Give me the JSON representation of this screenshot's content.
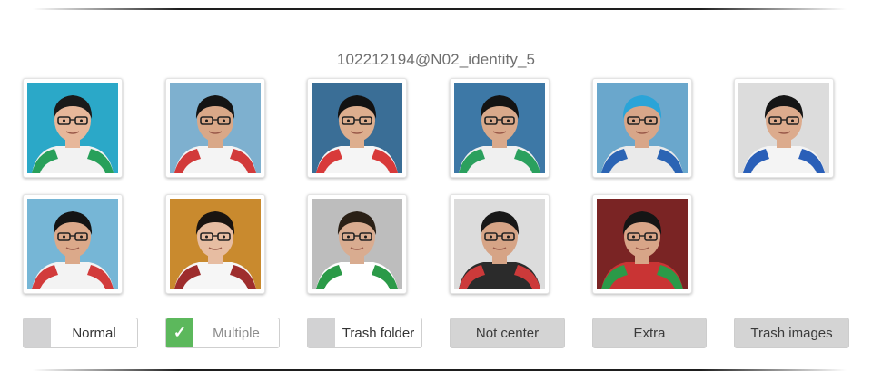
{
  "header": {
    "title": "102212194@N02_identity_5"
  },
  "faces": [
    {
      "bg": "#2ba8c8",
      "hair": "#1a1a1a",
      "skin": "#e7b79a",
      "shirt": "#f2f2f2",
      "trim": "#28a05a"
    },
    {
      "bg": "#7eb0cf",
      "hair": "#141414",
      "skin": "#d9a888",
      "shirt": "#f4f4f4",
      "trim": "#d23a3a"
    },
    {
      "bg": "#3a6e96",
      "hair": "#121212",
      "skin": "#ddae8e",
      "shirt": "#f5f5f5",
      "trim": "#d83a3a"
    },
    {
      "bg": "#3d78a6",
      "hair": "#131313",
      "skin": "#d9a98b",
      "shirt": "#f0f0f0",
      "trim": "#2ba05e"
    },
    {
      "bg": "#6aa7cc",
      "hair": "#2aa4d8",
      "skin": "#d8a689",
      "shirt": "#eaeaea",
      "trim": "#2b64b4"
    },
    {
      "bg": "#dcdcdc",
      "hair": "#151515",
      "skin": "#dcab8d",
      "shirt": "#f4f4f4",
      "trim": "#2a5fb8"
    },
    {
      "bg": "#76b6d6",
      "hair": "#141414",
      "skin": "#dba98a",
      "shirt": "#f3f3f3",
      "trim": "#d23b3b"
    },
    {
      "bg": "#c98a2e",
      "hair": "#1a1410",
      "skin": "#e7bda2",
      "shirt": "#f6f6f6",
      "trim": "#9e2d2d"
    },
    {
      "bg": "#bdbdbd",
      "hair": "#2a2016",
      "skin": "#d9ac90",
      "shirt": "#ffffff",
      "trim": "#2b9a48"
    },
    {
      "bg": "#dcdcdc",
      "hair": "#181818",
      "skin": "#d6a486",
      "shirt": "#2b2b2b",
      "trim": "#cc3a3a"
    },
    {
      "bg": "#7a2424",
      "hair": "#151515",
      "skin": "#d8a588",
      "shirt": "#c93434",
      "trim": "#2b9a48"
    }
  ],
  "controls": {
    "normal": "Normal",
    "multiple": "Multiple",
    "multiple_check": "✓",
    "trash_folder": "Trash folder",
    "not_center": "Not center",
    "extra": "Extra",
    "trash_images": "Trash images"
  }
}
